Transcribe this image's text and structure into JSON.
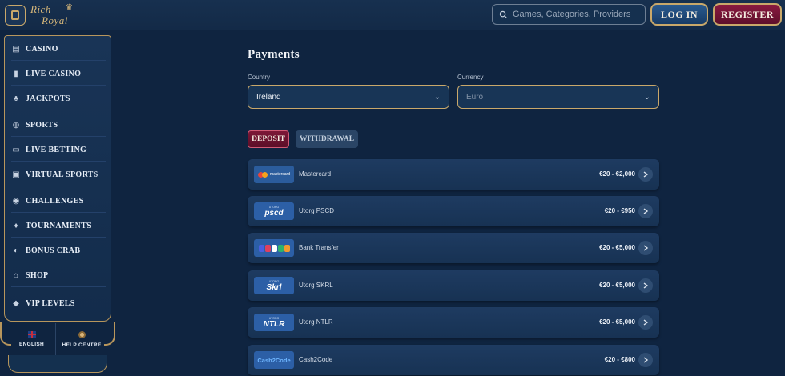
{
  "header": {
    "logo_line1": "Rich",
    "logo_line2": "Royal",
    "search_placeholder": "Games, Categories, Providers",
    "login_label": "LOG IN",
    "register_label": "REGISTER"
  },
  "sidebar": {
    "items": [
      {
        "label": "CASINO",
        "icon": "slot-icon"
      },
      {
        "label": "LIVE CASINO",
        "icon": "cards-icon"
      },
      {
        "label": "JACKPOTS",
        "icon": "clover-icon"
      },
      {
        "label": "SPORTS",
        "icon": "ball-icon"
      },
      {
        "label": "LIVE BETTING",
        "icon": "screen-icon"
      },
      {
        "label": "VIRTUAL SPORTS",
        "icon": "monitor-icon"
      },
      {
        "label": "CHALLENGES",
        "icon": "medal-icon"
      },
      {
        "label": "TOURNAMENTS",
        "icon": "trophy-icon"
      },
      {
        "label": "BONUS CRAB",
        "icon": "crab-icon"
      },
      {
        "label": "SHOP",
        "icon": "basket-icon"
      },
      {
        "label": "VIP LEVELS",
        "icon": "diamond-icon"
      }
    ],
    "language_label": "ENGLISH",
    "help_label": "HELP CENTRE"
  },
  "main": {
    "title": "Payments",
    "country_label": "Country",
    "country_value": "Ireland",
    "currency_label": "Currency",
    "currency_value": "Euro",
    "tab_deposit": "DEPOSIT",
    "tab_withdrawal": "WITHDRAWAL",
    "methods": [
      {
        "name": "Mastercard",
        "range": "€20 - €2,000",
        "logo": "mastercard"
      },
      {
        "name": "Utorg PSCD",
        "range": "€20 - €950",
        "logo_text": "pscd"
      },
      {
        "name": "Bank Transfer",
        "range": "€20 - €5,000",
        "logo": "bank"
      },
      {
        "name": "Utorg SKRL",
        "range": "€20 - €5,000",
        "logo_text": "Skrl"
      },
      {
        "name": "Utorg NTLR",
        "range": "€20 - €5,000",
        "logo_text": "NTLR"
      },
      {
        "name": "Cash2Code",
        "range": "€20 - €800",
        "logo_text": "Cash2Code"
      }
    ],
    "logo_small_text": {
      "mastercard": "mastercard",
      "utorg": "UTORG"
    }
  },
  "colors": {
    "background": "#0f2440",
    "gold": "#c9a86a",
    "register": "#8a1a40",
    "login": "#2a5a8f"
  }
}
